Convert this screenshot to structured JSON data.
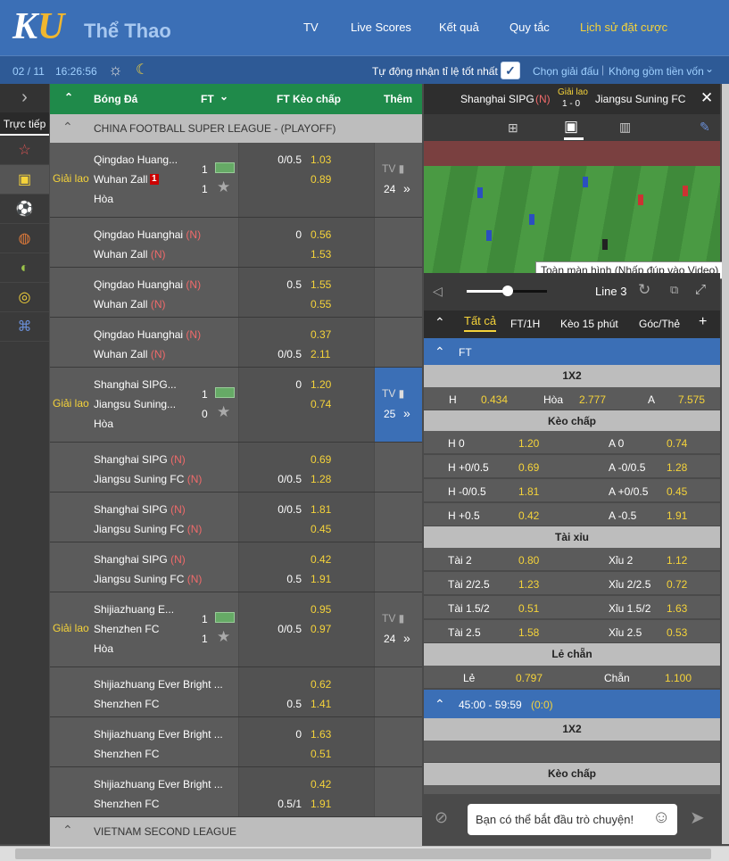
{
  "header": {
    "logo_k": "K",
    "logo_u": "U",
    "title": "Thể Thao",
    "nav": [
      "TV",
      "Live Scores",
      "Kết quả",
      "Quy tắc",
      "Lịch sử đặt cược"
    ]
  },
  "subbar": {
    "date": "02 / 11",
    "time": "16:26:56",
    "auto_label": "Tự động nhận tỉ lệ tốt nhất",
    "choose": "Chọn giải đấu",
    "nocapital": "Không gồm tiền vốn"
  },
  "sidebar": {
    "live": "Trực tiếp"
  },
  "main_head": {
    "sport": "Bóng Đá",
    "ft": "FT",
    "handicap": "FT Kèo chấp",
    "more": "Thêm"
  },
  "league1": "CHINA FOOTBALL SUPER LEAGUE - (PLAYOFF)",
  "league2": "VIETNAM SECOND LEAGUE",
  "matches": [
    {
      "status": "Giải lao",
      "t1": "Qingdao Huang...",
      "t2": "Wuhan Zall",
      "red": "1",
      "draw": "Hòa",
      "s1": "1",
      "s2": "1",
      "lines": [
        [
          "0/0.5",
          "1.03"
        ],
        [
          "",
          "0.89"
        ]
      ],
      "tv": "24",
      "tvlabel": "TV",
      "h": 84
    },
    {
      "t1": "Qingdao Huanghai",
      "t2": "Wuhan Zall",
      "n": "(N)",
      "lines": [
        [
          "0",
          "0.56"
        ],
        [
          "",
          "1.53"
        ]
      ],
      "h": 56
    },
    {
      "t1": "Qingdao Huanghai",
      "t2": "Wuhan Zall",
      "n": "(N)",
      "lines": [
        [
          "0.5",
          "1.55"
        ],
        [
          "",
          "0.55"
        ]
      ],
      "h": 56
    },
    {
      "t1": "Qingdao Huanghai",
      "t2": "Wuhan Zall",
      "n": "(N)",
      "lines": [
        [
          "",
          "0.37"
        ],
        [
          "0/0.5",
          "2.11"
        ]
      ],
      "h": 56
    },
    {
      "status": "Giải lao",
      "t1": "Shanghai SIPG...",
      "t2": "Jiangsu Suning...",
      "draw": "Hòa",
      "s1": "1",
      "s2": "0",
      "lines": [
        [
          "0",
          "1.20"
        ],
        [
          "",
          "0.74"
        ]
      ],
      "tv": "25",
      "tvlabel": "TV",
      "h": 84,
      "blue": true
    },
    {
      "t1": "Shanghai SIPG",
      "t2": "Jiangsu Suning FC",
      "n": "(N)",
      "lines": [
        [
          "",
          "0.69"
        ],
        [
          "0/0.5",
          "1.28"
        ]
      ],
      "h": 56
    },
    {
      "t1": "Shanghai SIPG",
      "t2": "Jiangsu Suning FC",
      "n": "(N)",
      "lines": [
        [
          "0/0.5",
          "1.81"
        ],
        [
          "",
          "0.45"
        ]
      ],
      "h": 56
    },
    {
      "t1": "Shanghai SIPG",
      "t2": "Jiangsu Suning FC",
      "n": "(N)",
      "lines": [
        [
          "",
          "0.42"
        ],
        [
          "0.5",
          "1.91"
        ]
      ],
      "h": 56
    },
    {
      "status": "Giải lao",
      "t1": "Shijiazhuang E...",
      "t2": "Shenzhen FC",
      "draw": "Hòa",
      "s1": "1",
      "s2": "1",
      "lines": [
        [
          "",
          "0.95"
        ],
        [
          "0/0.5",
          "0.97"
        ]
      ],
      "tv": "24",
      "tvlabel": "TV",
      "h": 84
    },
    {
      "t1": "Shijiazhuang Ever Bright ...",
      "t2": "Shenzhen FC",
      "lines": [
        [
          "",
          "0.62"
        ],
        [
          "0.5",
          "1.41"
        ]
      ],
      "h": 56
    },
    {
      "t1": "Shijiazhuang Ever Bright ...",
      "t2": "Shenzhen FC",
      "lines": [
        [
          "0",
          "1.63"
        ],
        [
          "",
          "0.51"
        ]
      ],
      "h": 56
    },
    {
      "t1": "Shijiazhuang Ever Bright ...",
      "t2": "Shenzhen FC",
      "lines": [
        [
          "",
          "0.42"
        ],
        [
          "0.5/1",
          "1.91"
        ]
      ],
      "h": 56
    }
  ],
  "right": {
    "home": "Shanghai SIPG",
    "n": "(N)",
    "status": "Giải lao",
    "score": "1 - 0",
    "away": "Jiangsu Suning FC",
    "tooltip": "Toàn màn hình (Nhấp đúp vào Video)",
    "line": "Line 3",
    "tabs": [
      "Tất cả",
      "FT/1H",
      "Kèo 15 phút",
      "Góc/Thẻ"
    ],
    "ft": "FT",
    "s1x2": "1X2",
    "h": "H",
    "h_val": "0.434",
    "draw": "Hòa",
    "draw_val": "2.777",
    "a": "A",
    "a_val": "7.575",
    "handicap": "Kèo chấp",
    "hrows": [
      [
        "H 0",
        "1.20",
        "A 0",
        "0.74"
      ],
      [
        "H +0/0.5",
        "0.69",
        "A -0/0.5",
        "1.28"
      ],
      [
        "H -0/0.5",
        "1.81",
        "A +0/0.5",
        "0.45"
      ],
      [
        "H +0.5",
        "0.42",
        "A -0.5",
        "1.91"
      ]
    ],
    "ou": "Tài xỉu",
    "ourows": [
      [
        "Tài 2",
        "0.80",
        "Xỉu 2",
        "1.12"
      ],
      [
        "Tài 2/2.5",
        "1.23",
        "Xỉu 2/2.5",
        "0.72"
      ],
      [
        "Tài 1.5/2",
        "0.51",
        "Xỉu 1.5/2",
        "1.63"
      ],
      [
        "Tài 2.5",
        "1.58",
        "Xỉu 2.5",
        "0.53"
      ]
    ],
    "oe": "Lẻ chẵn",
    "odd": "Lẻ",
    "odd_val": "0.797",
    "even": "Chẵn",
    "even_val": "1.100",
    "period": "45:00 - 59:59",
    "period_score": "(0:0)",
    "s1x2b": "1X2",
    "handicap2": "Kèo chấp",
    "chat_placeholder": "Bạn có thể bắt đầu trò chuyện!"
  }
}
